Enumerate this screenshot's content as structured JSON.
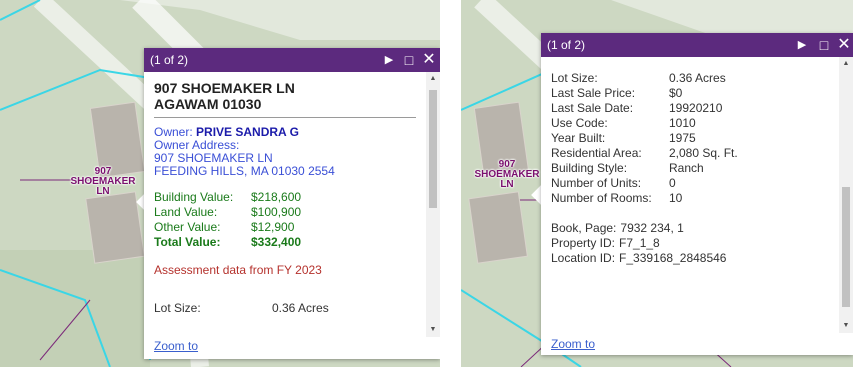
{
  "left_popup": {
    "counter": "(1 of 2)",
    "address_line1": "907 SHOEMAKER LN",
    "address_line2": "AGAWAM 01030",
    "owner_label": "Owner:",
    "owner_name": "PRIVE SANDRA G",
    "owner_address_label": "Owner Address:",
    "owner_address_line1": "907 SHOEMAKER LN",
    "owner_address_line2": "FEEDING HILLS, MA 01030 2554",
    "values": [
      {
        "label": "Building Value:",
        "value": "$218,600"
      },
      {
        "label": "Land Value:",
        "value": "$100,900"
      },
      {
        "label": "Other Value:",
        "value": "$12,900"
      },
      {
        "label": "Total Value:",
        "value": "$332,400"
      }
    ],
    "assessment_note": "Assessment data from FY 2023",
    "lot_size_label": "Lot Size:",
    "lot_size_value": "0.36 Acres",
    "zoom_link": "Zoom to"
  },
  "right_popup": {
    "counter": "(1 of 2)",
    "details": [
      {
        "label": "Lot Size:",
        "value": "0.36 Acres"
      },
      {
        "label": "Last Sale Price:",
        "value": "$0"
      },
      {
        "label": "Last Sale Date:",
        "value": "19920210"
      },
      {
        "label": "Use Code:",
        "value": "1010"
      },
      {
        "label": "Year Built:",
        "value": "1975"
      },
      {
        "label": "Residential Area:",
        "value": "2,080 Sq. Ft."
      },
      {
        "label": "Building Style:",
        "value": "Ranch"
      },
      {
        "label": "Number of Units:",
        "value": "0"
      },
      {
        "label": "Number of Rooms:",
        "value": "10"
      }
    ],
    "ids": [
      {
        "label": "Book, Page:",
        "value": "7932 234, 1"
      },
      {
        "label": "Property ID:",
        "value": "F7_1_8"
      },
      {
        "label": "Location ID:",
        "value": "F_339168_2848546"
      }
    ],
    "zoom_link": "Zoom to"
  },
  "map_labels": {
    "left": [
      "907",
      "SHOEMAKER",
      "LN"
    ],
    "right": [
      "907",
      "SHOEMAKER",
      "LN"
    ]
  },
  "icons": {
    "next": "next-arrow-icon",
    "maximize": "maximize-icon",
    "close": "close-icon"
  },
  "colors": {
    "header": "#5c2a7e",
    "parcel_line": "#3ad6e6",
    "label": "#7a0f6e",
    "values_green": "#1a7a1a",
    "owner_blue": "#3a4fd6",
    "note_red": "#b5322d"
  }
}
